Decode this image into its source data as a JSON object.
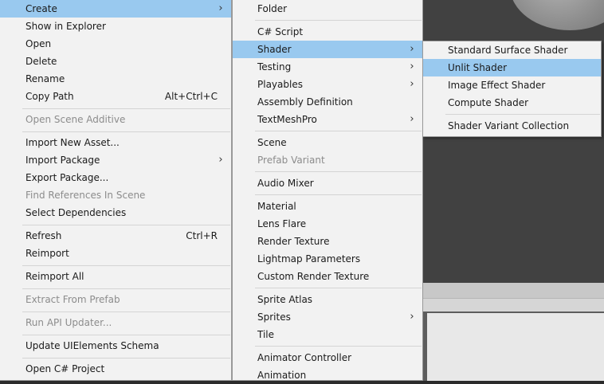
{
  "menu_main": {
    "items": [
      {
        "label": "Create",
        "arrow": true,
        "selected": true
      },
      {
        "label": "Show in Explorer"
      },
      {
        "label": "Open"
      },
      {
        "label": "Delete"
      },
      {
        "label": "Rename"
      },
      {
        "label": "Copy Path",
        "shortcut": "Alt+Ctrl+C"
      },
      {
        "label": "Open Scene Additive",
        "disabled": true
      },
      {
        "label": "Import New Asset..."
      },
      {
        "label": "Import Package",
        "arrow": true
      },
      {
        "label": "Export Package..."
      },
      {
        "label": "Find References In Scene",
        "disabled": true
      },
      {
        "label": "Select Dependencies"
      },
      {
        "label": "Refresh",
        "shortcut": "Ctrl+R"
      },
      {
        "label": "Reimport"
      },
      {
        "label": "Reimport All"
      },
      {
        "label": "Extract From Prefab",
        "disabled": true
      },
      {
        "label": "Run API Updater...",
        "disabled": true
      },
      {
        "label": "Update UIElements Schema"
      },
      {
        "label": "Open C# Project"
      }
    ]
  },
  "menu_create": {
    "items": [
      {
        "label": "Folder"
      },
      {
        "label": "C# Script"
      },
      {
        "label": "Shader",
        "arrow": true,
        "selected": true
      },
      {
        "label": "Testing",
        "arrow": true
      },
      {
        "label": "Playables",
        "arrow": true
      },
      {
        "label": "Assembly Definition"
      },
      {
        "label": "TextMeshPro",
        "arrow": true
      },
      {
        "label": "Scene"
      },
      {
        "label": "Prefab Variant",
        "disabled": true
      },
      {
        "label": "Audio Mixer"
      },
      {
        "label": "Material"
      },
      {
        "label": "Lens Flare"
      },
      {
        "label": "Render Texture"
      },
      {
        "label": "Lightmap Parameters"
      },
      {
        "label": "Custom Render Texture"
      },
      {
        "label": "Sprite Atlas"
      },
      {
        "label": "Sprites",
        "arrow": true
      },
      {
        "label": "Tile"
      },
      {
        "label": "Animator Controller"
      },
      {
        "label": "Animation"
      }
    ]
  },
  "menu_shader": {
    "items": [
      {
        "label": "Standard Surface Shader"
      },
      {
        "label": "Unlit Shader",
        "selected": true
      },
      {
        "label": "Image Effect Shader"
      },
      {
        "label": "Compute Shader"
      },
      {
        "label": "Shader Variant Collection"
      }
    ]
  },
  "glyphs": {
    "submenu_arrow": "›"
  },
  "colors": {
    "highlight": "#99c9ef",
    "menu_bg": "#f2f2f2",
    "disabled_text": "#8c8c8c"
  }
}
